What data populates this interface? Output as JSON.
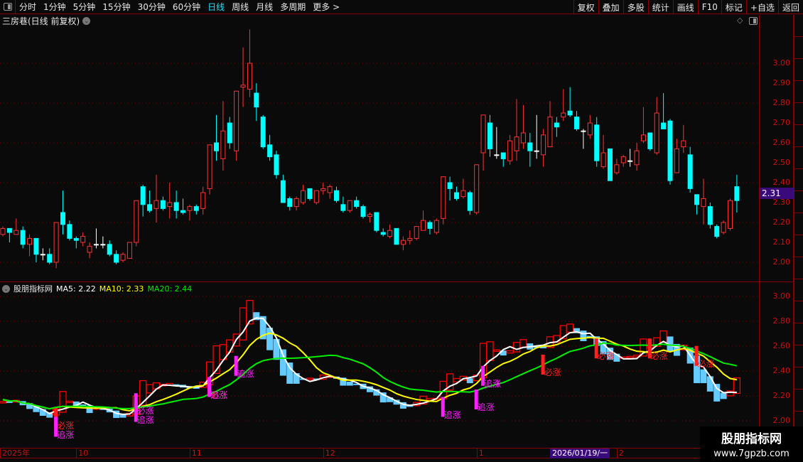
{
  "toolbar": {
    "periods": [
      "分时",
      "1分钟",
      "5分钟",
      "15分钟",
      "30分钟",
      "60分钟",
      "日线",
      "周线",
      "月线",
      "多周期",
      "更多 >"
    ],
    "active_period": "日线",
    "buttons": [
      "复权",
      "叠加",
      "多股",
      "统计",
      "画线",
      "F10",
      "标记",
      "+自选",
      "返回"
    ]
  },
  "chart_title": "三房巷(日线 前复权)",
  "current_price": "2.31",
  "price_axis_labels": [
    "3.00",
    "2.90",
    "2.80",
    "2.70",
    "2.60",
    "2.50",
    "2.40",
    "2.30",
    "2.20",
    "2.10",
    "2.00"
  ],
  "indicator": {
    "name": "股朋指标网",
    "ma5": "MA5: 2.22",
    "ma10": "MA10: 2.33",
    "ma20": "MA20: 2.44",
    "axis_labels": [
      "3.00",
      "2.80",
      "2.60",
      "2.40",
      "2.20",
      "2.00"
    ],
    "signals": [
      {
        "i": 8,
        "text": "必涨",
        "color": "#ff2020",
        "level": 1.93
      },
      {
        "i": 8,
        "text": "追涨",
        "color": "#ff20ff",
        "level": 1.86
      },
      {
        "i": 20,
        "text": "必涨",
        "color": "#ff20ff",
        "level": 2.05
      },
      {
        "i": 20,
        "text": "追涨",
        "color": "#ff20ff",
        "level": 1.98
      },
      {
        "i": 31,
        "text": "必涨",
        "color": "#ff2020",
        "level": 2.18
      },
      {
        "i": 31,
        "text": "追涨",
        "color": "#ff20ff",
        "level": 2.18
      },
      {
        "i": 35,
        "text": "追涨",
        "color": "#ff20ff",
        "level": 2.35
      },
      {
        "i": 66,
        "text": "追涨",
        "color": "#ff20ff",
        "level": 2.02
      },
      {
        "i": 71,
        "text": "追涨",
        "color": "#ff20ff",
        "level": 2.08
      },
      {
        "i": 72,
        "text": "追涨",
        "color": "#ff20ff",
        "level": 2.27
      },
      {
        "i": 81,
        "text": "必涨",
        "color": "#ff2020",
        "level": 2.36
      },
      {
        "i": 89,
        "text": "必涨",
        "color": "#ff2020",
        "level": 2.49
      },
      {
        "i": 97,
        "text": "必涨",
        "color": "#ff2020",
        "level": 2.49
      },
      {
        "i": 104,
        "text": "必涨",
        "color": "#ff2020",
        "level": 2.43
      }
    ]
  },
  "time_axis": [
    {
      "i": 0,
      "label": "2025年"
    },
    {
      "i": 11,
      "label": "10"
    },
    {
      "i": 28,
      "label": "11"
    },
    {
      "i": 48,
      "label": "12"
    },
    {
      "i": 71,
      "label": "1"
    },
    {
      "i": 82,
      "label": "2026/01/19/一",
      "highlight": true
    },
    {
      "i": 92,
      "label": "2"
    }
  ],
  "watermark": {
    "name": "股朋指标网",
    "url": "www.7gpzb.com"
  },
  "colors": {
    "up": "#ff3333",
    "down": "#00ffff",
    "flat": "#ffffff",
    "ma5": "#ffffff",
    "ma10": "#ffff00",
    "ma20": "#00ee00",
    "grid": "#8b0000",
    "accent": "#3a0a7a",
    "box_down": "#66ccff",
    "box_up": "#ff0000"
  },
  "chart_data": {
    "type": "candlestick",
    "fields": [
      "open",
      "high",
      "low",
      "close"
    ],
    "ylim": [
      1.95,
      3.2
    ],
    "grid": true,
    "ohlc": [
      [
        2.14,
        2.18,
        2.13,
        2.17
      ],
      [
        2.17,
        2.17,
        2.1,
        2.15
      ],
      [
        2.14,
        2.22,
        2.14,
        2.16
      ],
      [
        2.16,
        2.18,
        2.07,
        2.09
      ],
      [
        2.09,
        2.14,
        2.03,
        2.12
      ],
      [
        2.12,
        2.12,
        2.0,
        2.04
      ],
      [
        2.04,
        2.07,
        2.01,
        2.04
      ],
      [
        2.04,
        2.07,
        1.99,
        2.0
      ],
      [
        2.0,
        2.2,
        1.97,
        2.2
      ],
      [
        2.25,
        2.36,
        2.14,
        2.19
      ],
      [
        2.19,
        2.21,
        2.11,
        2.12
      ],
      [
        2.12,
        2.13,
        2.07,
        2.11
      ],
      [
        2.1,
        2.15,
        2.08,
        2.13
      ],
      [
        2.05,
        2.1,
        2.02,
        2.08
      ],
      [
        2.09,
        2.17,
        2.07,
        2.09
      ],
      [
        2.09,
        2.13,
        2.07,
        2.09
      ],
      [
        2.09,
        2.11,
        2.03,
        2.04
      ],
      [
        2.04,
        2.06,
        1.99,
        2.0
      ],
      [
        2.01,
        2.05,
        2.0,
        2.04
      ],
      [
        2.02,
        2.1,
        2.02,
        2.1
      ],
      [
        2.1,
        2.31,
        2.08,
        2.31
      ],
      [
        2.38,
        2.39,
        2.23,
        2.29
      ],
      [
        2.29,
        2.36,
        2.25,
        2.26
      ],
      [
        2.27,
        2.44,
        2.2,
        2.31
      ],
      [
        2.31,
        2.33,
        2.26,
        2.27
      ],
      [
        2.28,
        2.4,
        2.22,
        2.3
      ],
      [
        2.3,
        2.36,
        2.22,
        2.26
      ],
      [
        2.26,
        2.32,
        2.24,
        2.25
      ],
      [
        2.26,
        2.29,
        2.21,
        2.28
      ],
      [
        2.28,
        2.29,
        2.24,
        2.26
      ],
      [
        2.27,
        2.38,
        2.24,
        2.35
      ],
      [
        2.37,
        2.59,
        2.34,
        2.59
      ],
      [
        2.6,
        2.74,
        2.51,
        2.56
      ],
      [
        2.52,
        2.81,
        2.46,
        2.66
      ],
      [
        2.7,
        2.73,
        2.57,
        2.6
      ],
      [
        2.56,
        2.86,
        2.51,
        2.86
      ],
      [
        2.88,
        3.08,
        2.78,
        2.89
      ],
      [
        2.87,
        3.17,
        2.83,
        3.0
      ],
      [
        2.85,
        2.9,
        2.71,
        2.78
      ],
      [
        2.73,
        2.74,
        2.57,
        2.58
      ],
      [
        2.59,
        2.64,
        2.51,
        2.53
      ],
      [
        2.54,
        2.56,
        2.42,
        2.44
      ],
      [
        2.41,
        2.44,
        2.3,
        2.3
      ],
      [
        2.32,
        2.33,
        2.26,
        2.28
      ],
      [
        2.28,
        2.33,
        2.26,
        2.32
      ],
      [
        2.3,
        2.39,
        2.29,
        2.36
      ],
      [
        2.37,
        2.37,
        2.31,
        2.32
      ],
      [
        2.3,
        2.36,
        2.29,
        2.36
      ],
      [
        2.36,
        2.4,
        2.34,
        2.37
      ],
      [
        2.35,
        2.39,
        2.32,
        2.38
      ],
      [
        2.36,
        2.38,
        2.3,
        2.31
      ],
      [
        2.29,
        2.33,
        2.25,
        2.26
      ],
      [
        2.26,
        2.31,
        2.25,
        2.31
      ],
      [
        2.31,
        2.33,
        2.27,
        2.28
      ],
      [
        2.28,
        2.29,
        2.22,
        2.23
      ],
      [
        2.23,
        2.25,
        2.2,
        2.24
      ],
      [
        2.25,
        2.25,
        2.15,
        2.16
      ],
      [
        2.15,
        2.17,
        2.13,
        2.14
      ],
      [
        2.13,
        2.19,
        2.12,
        2.16
      ],
      [
        2.17,
        2.17,
        2.09,
        2.09
      ],
      [
        2.09,
        2.13,
        2.06,
        2.11
      ],
      [
        2.11,
        2.16,
        2.09,
        2.12
      ],
      [
        2.12,
        2.18,
        2.11,
        2.18
      ],
      [
        2.16,
        2.26,
        2.16,
        2.21
      ],
      [
        2.2,
        2.21,
        2.14,
        2.17
      ],
      [
        2.15,
        2.22,
        2.14,
        2.21
      ],
      [
        2.22,
        2.43,
        2.19,
        2.43
      ],
      [
        2.4,
        2.43,
        2.31,
        2.37
      ],
      [
        2.35,
        2.38,
        2.31,
        2.32
      ],
      [
        2.33,
        2.42,
        2.32,
        2.36
      ],
      [
        2.35,
        2.36,
        2.24,
        2.26
      ],
      [
        2.25,
        2.49,
        2.24,
        2.49
      ],
      [
        2.55,
        2.74,
        2.46,
        2.74
      ],
      [
        2.7,
        2.74,
        2.53,
        2.57
      ],
      [
        2.54,
        2.68,
        2.52,
        2.54
      ],
      [
        2.55,
        2.55,
        2.48,
        2.52
      ],
      [
        2.51,
        2.64,
        2.49,
        2.61
      ],
      [
        2.56,
        2.82,
        2.51,
        2.63
      ],
      [
        2.6,
        2.79,
        2.57,
        2.65
      ],
      [
        2.6,
        2.65,
        2.48,
        2.56
      ],
      [
        2.56,
        2.74,
        2.52,
        2.56
      ],
      [
        2.54,
        2.67,
        2.48,
        2.64
      ],
      [
        2.58,
        2.81,
        2.58,
        2.73
      ],
      [
        2.7,
        2.73,
        2.63,
        2.68
      ],
      [
        2.73,
        2.87,
        2.71,
        2.75
      ],
      [
        2.76,
        2.88,
        2.73,
        2.74
      ],
      [
        2.73,
        2.76,
        2.66,
        2.67
      ],
      [
        2.66,
        2.67,
        2.57,
        2.66
      ],
      [
        2.64,
        2.74,
        2.62,
        2.7
      ],
      [
        2.69,
        2.73,
        2.48,
        2.51
      ],
      [
        2.48,
        2.64,
        2.47,
        2.55
      ],
      [
        2.57,
        2.57,
        2.41,
        2.41
      ],
      [
        2.45,
        2.52,
        2.44,
        2.49
      ],
      [
        2.5,
        2.54,
        2.48,
        2.53
      ],
      [
        2.51,
        2.57,
        2.48,
        2.51
      ],
      [
        2.49,
        2.6,
        2.46,
        2.56
      ],
      [
        2.61,
        2.78,
        2.6,
        2.64
      ],
      [
        2.65,
        2.65,
        2.56,
        2.57
      ],
      [
        2.55,
        2.83,
        2.54,
        2.75
      ],
      [
        2.7,
        2.85,
        2.67,
        2.67
      ],
      [
        2.71,
        2.72,
        2.39,
        2.41
      ],
      [
        2.45,
        2.62,
        2.45,
        2.57
      ],
      [
        2.58,
        2.69,
        2.55,
        2.61
      ],
      [
        2.54,
        2.58,
        2.35,
        2.37
      ],
      [
        2.34,
        2.34,
        2.24,
        2.29
      ],
      [
        2.28,
        2.42,
        2.19,
        2.32
      ],
      [
        2.28,
        2.3,
        2.17,
        2.19
      ],
      [
        2.18,
        2.19,
        2.12,
        2.13
      ],
      [
        2.15,
        2.21,
        2.14,
        2.2
      ],
      [
        2.17,
        2.32,
        2.16,
        2.31
      ],
      [
        2.38,
        2.44,
        2.25,
        2.31
      ]
    ]
  }
}
